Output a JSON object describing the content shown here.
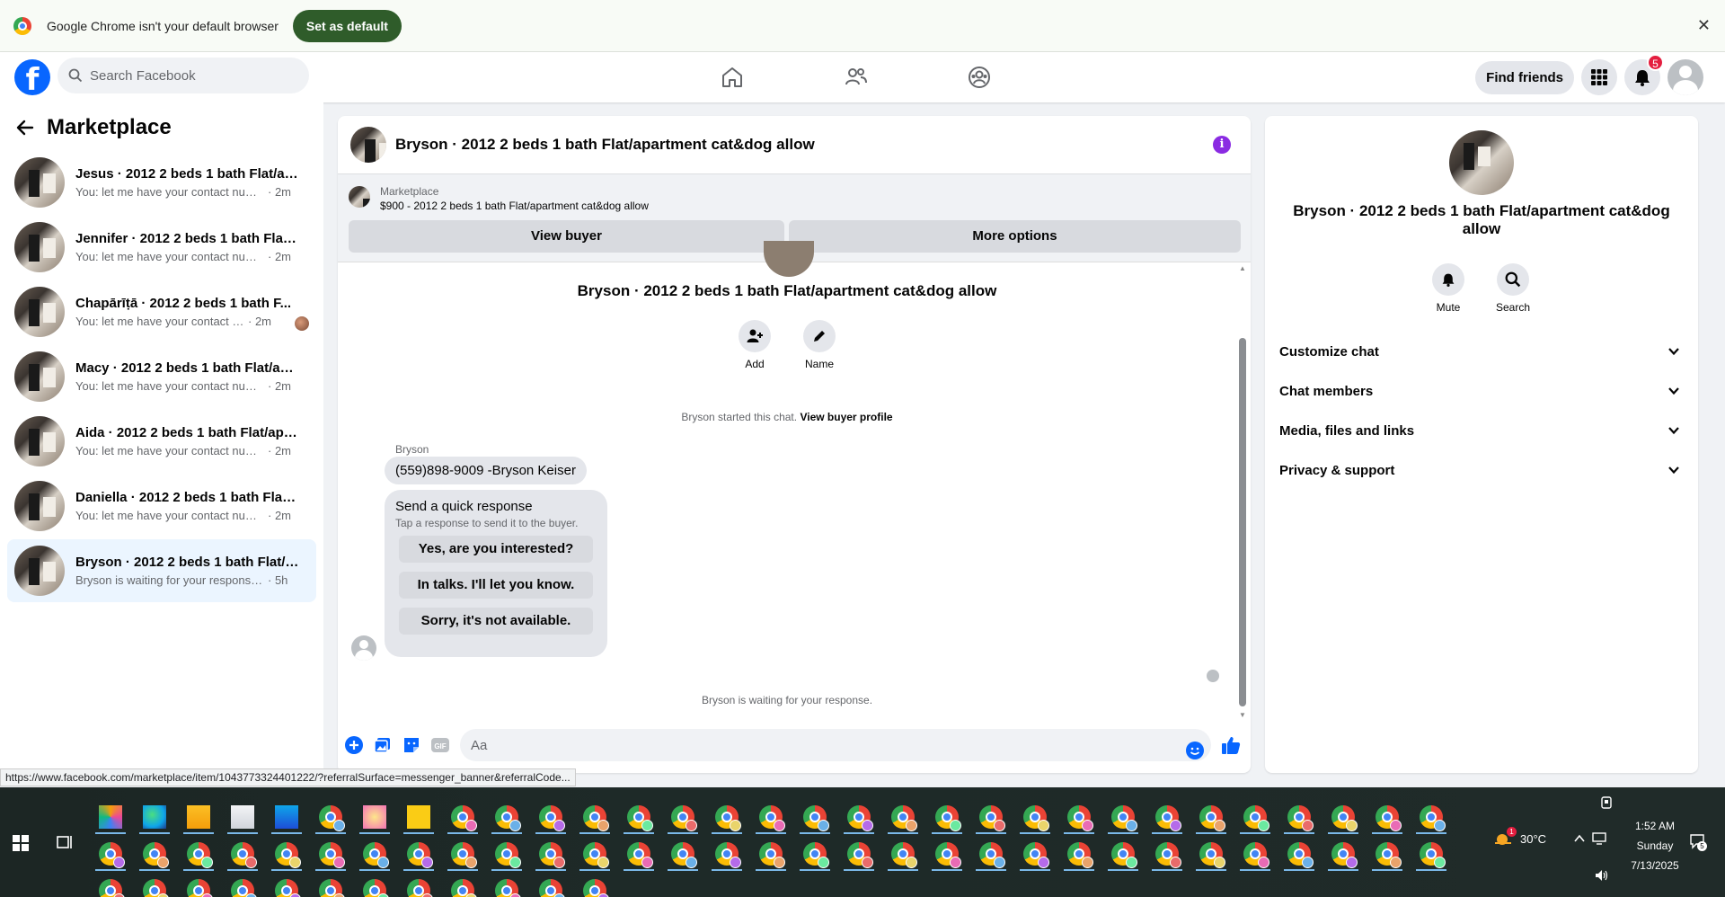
{
  "chrome_bar": {
    "message": "Google Chrome isn't your default browser",
    "set_default": "Set as default",
    "close": "✕"
  },
  "fb_header": {
    "logo": "f",
    "search_placeholder": "Search Facebook",
    "find_friends": "Find friends",
    "notification_count": "5"
  },
  "sidebar": {
    "title": "Marketplace",
    "conversations": [
      {
        "name": "Jesus · 2012 2 beds 1 bath Flat/apa...",
        "snippet": "You: let me have your contact numbe...",
        "time": "· 2m"
      },
      {
        "name": "Jennifer · 2012 2 beds 1 bath Flat/a...",
        "snippet": "You: let me have your contact numbe...",
        "time": "· 2m"
      },
      {
        "name": "Chapārīṭā · 2012 2 beds 1 bath F...",
        "snippet": "You: let me have your contact nu...",
        "time": "· 2m"
      },
      {
        "name": "Macy · 2012 2 beds 1 bath Flat/apa...",
        "snippet": "You: let me have your contact numbe...",
        "time": "· 2m"
      },
      {
        "name": "Aida · 2012 2 beds 1 bath Flat/apar...",
        "snippet": "You: let me have your contact numbe...",
        "time": "· 2m"
      },
      {
        "name": "Daniella · 2012 2 beds 1 bath Flat/a...",
        "snippet": "You: let me have your contact numbe...",
        "time": "· 2m"
      },
      {
        "name": "Bryson · 2012 2 beds 1 bath Flat/a...",
        "snippet": "Bryson is waiting for your response........",
        "time": "· 5h"
      }
    ]
  },
  "chat": {
    "title": "Bryson · 2012 2 beds 1 bath Flat/apartment cat&dog allow",
    "banner_label": "Marketplace",
    "banner_item": "$900 - 2012 2 beds 1 bath Flat/apartment cat&dog allow",
    "view_buyer": "View buyer",
    "more_options": "More options",
    "conv_title": "Bryson · 2012 2 beds 1 bath Flat/apartment cat&dog allow",
    "add_label": "Add",
    "name_label": "Name",
    "started_text": "Bryson started this chat.",
    "view_profile": "View buyer profile",
    "sender": "Bryson",
    "phone_message": "(559)898-9009 -Bryson Keiser",
    "quick_title": "Send a quick response",
    "quick_sub": "Tap a response to send it to the buyer.",
    "quick_replies": [
      "Yes, are you interested?",
      "In talks. I'll let you know.",
      "Sorry, it's not available."
    ],
    "waiting_text": "Bryson is waiting for your response.",
    "input_placeholder": "Aa"
  },
  "right_panel": {
    "title": "Bryson · 2012 2 beds 1 bath Flat/apartment cat&dog allow",
    "mute": "Mute",
    "search": "Search",
    "sections": [
      "Customize chat",
      "Chat members",
      "Media, files and links",
      "Privacy & support"
    ]
  },
  "status_url": "https://www.facebook.com/marketplace/item/1043773324401222/?referralSurface=messenger_banner&referralCode...",
  "taskbar": {
    "temperature": "30°C",
    "weather_badge": "1",
    "time": "1:52 AM",
    "day": "Sunday",
    "date": "7/13/2025",
    "notif_count": "5"
  },
  "colors": {
    "fb_blue": "#0866ff",
    "set_default_green": "#2f5c2a",
    "info_purple": "#8a2be2",
    "notif_red": "#e41e3f"
  }
}
